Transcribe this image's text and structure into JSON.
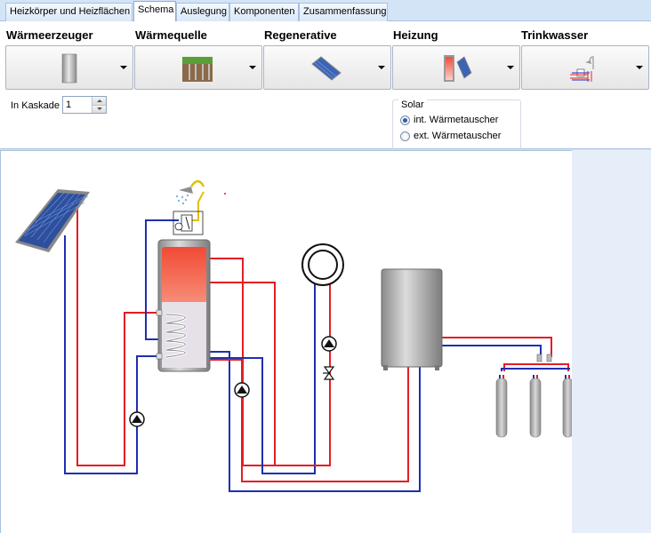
{
  "tabs": [
    {
      "label": "Heizkörper und Heizflächen"
    },
    {
      "label": "Schema"
    },
    {
      "label": "Auslegung"
    },
    {
      "label": "Komponenten"
    },
    {
      "label": "Zusammenfassung"
    }
  ],
  "active_tab": "Schema",
  "groups": [
    {
      "label": "Wärmeerzeuger",
      "icon": "boiler-icon"
    },
    {
      "label": "Wärmequelle",
      "icon": "ground-source-icon"
    },
    {
      "label": "Regenerative",
      "icon": "solar-panel-icon"
    },
    {
      "label": "Heizung",
      "icon": "buffer-tank-icon"
    },
    {
      "label": "Trinkwasser",
      "icon": "shower-icon"
    }
  ],
  "kaskade": {
    "label": "In Kaskade",
    "value": "1"
  },
  "solar": {
    "title": "Solar",
    "options": [
      {
        "label": "int. Wärmetauscher",
        "checked": true
      },
      {
        "label": "ext. Wärmetauscher",
        "checked": false
      }
    ]
  },
  "colors": {
    "supply": "#e31e24",
    "return": "#1f2fb0",
    "accent": "#f36c4a"
  }
}
